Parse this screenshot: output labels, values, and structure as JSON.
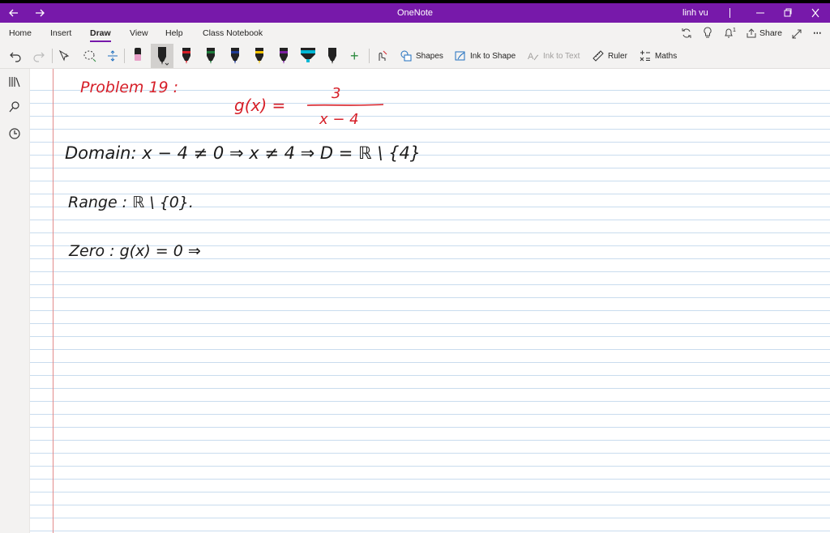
{
  "titlebar": {
    "app_title": "OneNote",
    "user_name": "linh vu",
    "back_icon": "arrow-left-icon",
    "forward_icon": "arrow-right-icon",
    "accent": "#7719aa"
  },
  "tabs": [
    {
      "label": "Home"
    },
    {
      "label": "Insert"
    },
    {
      "label": "Draw"
    },
    {
      "label": "View"
    },
    {
      "label": "Help"
    },
    {
      "label": "Class Notebook"
    }
  ],
  "active_tab": "Draw",
  "header_actions": {
    "share_label": "Share",
    "notification_count": "1"
  },
  "ribbon": {
    "shapes_label": "Shapes",
    "ink_to_shape_label": "Ink to Shape",
    "ink_to_text_label": "Ink to Text",
    "ruler_label": "Ruler",
    "maths_label": "Maths",
    "pen_colors": [
      "#222222",
      "#222222",
      "#d61f28",
      "#1d7a3a",
      "#1f3a93",
      "#f2c200",
      "#7a1fa0",
      "#00b7d4",
      "#222222"
    ]
  },
  "note": {
    "line1_label": "Problem 19 :",
    "line1_numer": "3",
    "line1_func": "g(x) =",
    "line1_denom": "x − 4",
    "line2": "Domain:    x − 4 ≠ 0   ⇒   x ≠ 4   ⇒   D = ℝ \\ {4}",
    "line3": "Range :   ℝ \\ {0}.",
    "line4": "Zero :    g(x) = 0    ⇒"
  }
}
